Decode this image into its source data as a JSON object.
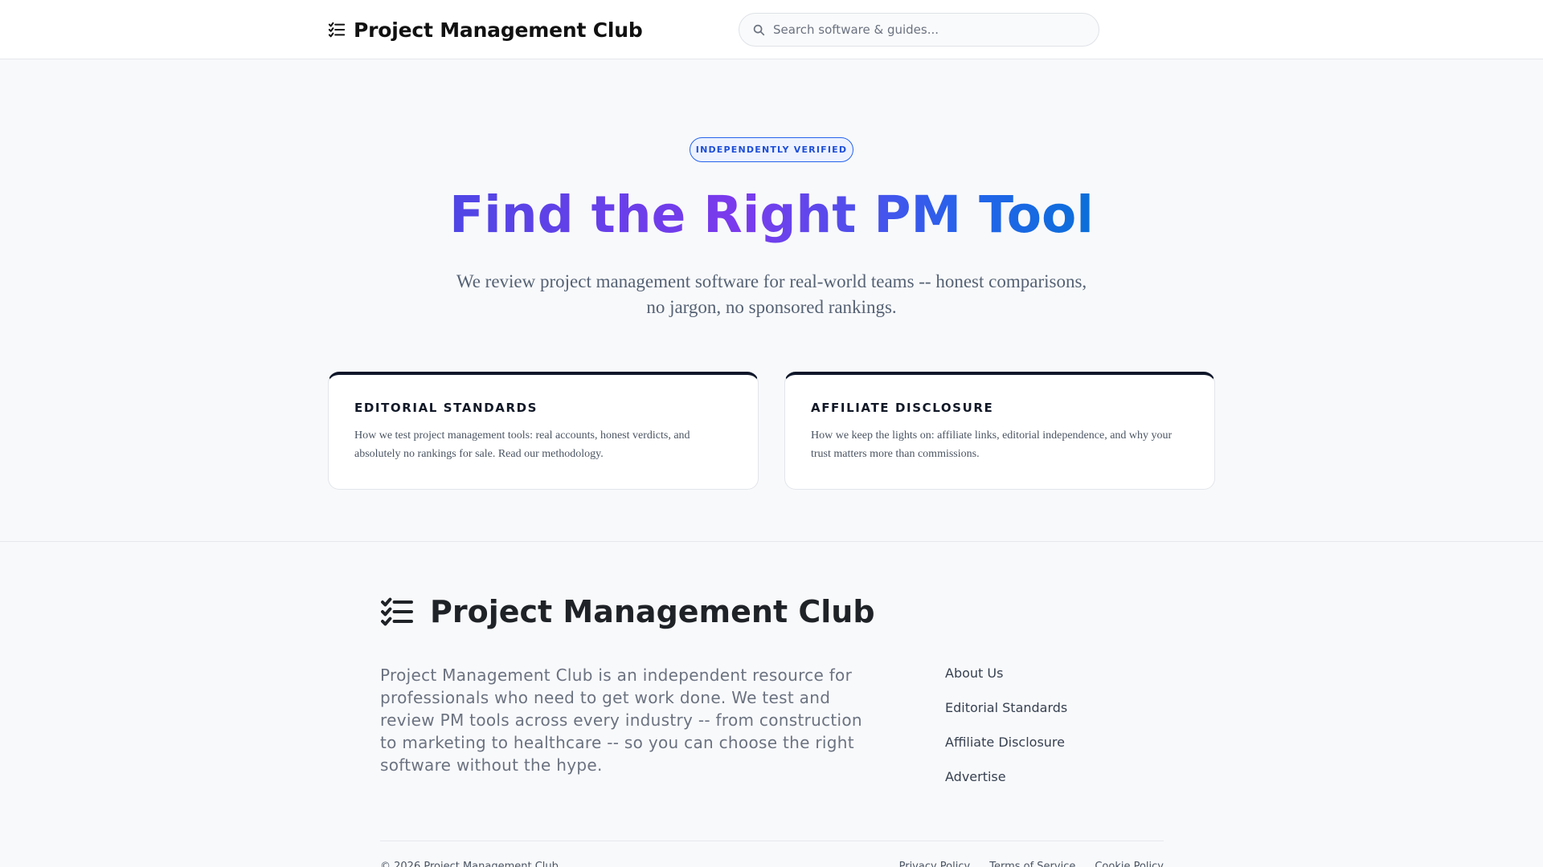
{
  "header": {
    "brand_name": "Project Management Club",
    "brand_icon": "checklist-icon",
    "search_icon": "search-icon",
    "search_placeholder": "Search software & guides..."
  },
  "hero": {
    "badge": "INDEPENDENTLY VERIFIED",
    "title": "Find the Right PM Tool",
    "subtitle": "We review project management software for real-world teams -- honest comparisons, no jargon, no sponsored rankings."
  },
  "cards": [
    {
      "title": "EDITORIAL STANDARDS",
      "body": "How we test project management tools: real accounts, honest verdicts, and absolutely no rankings for sale. Read our methodology."
    },
    {
      "title": "AFFILIATE DISCLOSURE",
      "body": "How we keep the lights on: affiliate links, editorial independence, and why your trust matters more than commissions."
    }
  ],
  "footer": {
    "brand_name": "Project Management Club",
    "description": "Project Management Club is an independent resource for professionals who need to get work done. We test and review PM tools across every industry -- from construction to marketing to healthcare -- so you can choose the right software without the hype.",
    "links": [
      "About Us",
      "Editorial Standards",
      "Affiliate Disclosure",
      "Advertise"
    ],
    "copyright": "© 2026 Project Management Club",
    "legal_links": [
      "Privacy Policy",
      "Terms of Service",
      "Cookie Policy"
    ]
  },
  "colors": {
    "accent": "#2563eb",
    "gradient_start": "#4f46e5",
    "gradient_end": "#0b6fd9",
    "card_border_top": "#0f172a"
  }
}
